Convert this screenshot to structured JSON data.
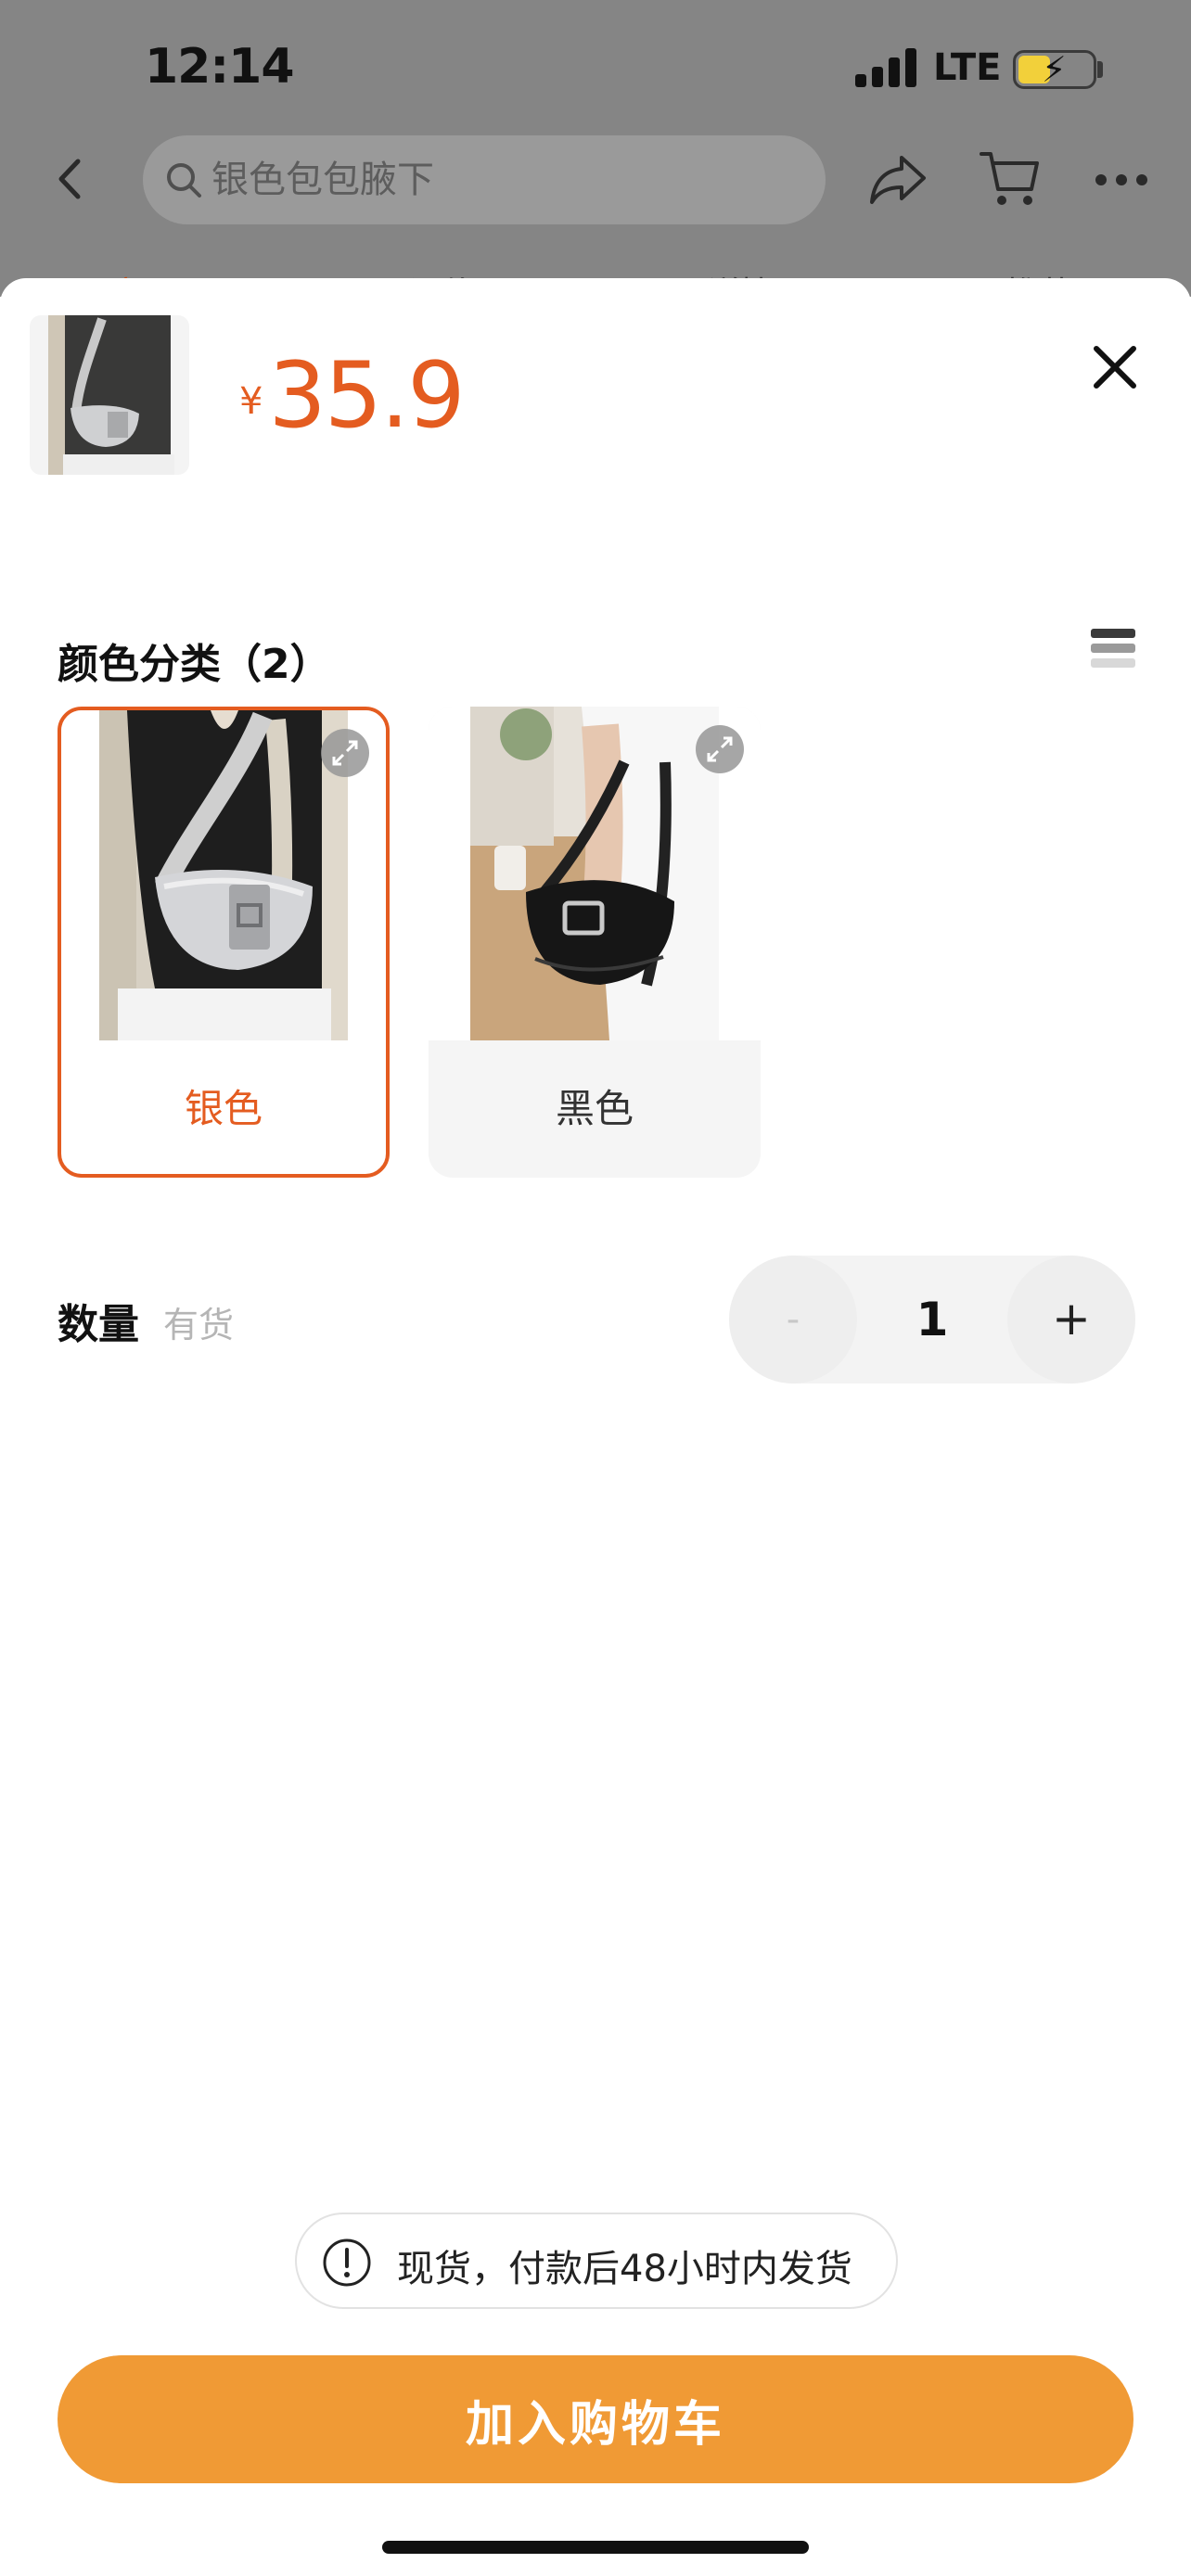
{
  "status_bar": {
    "time": "12:14",
    "network": "LTE"
  },
  "search": {
    "placeholder": "银色包包腋下"
  },
  "tabs_peek": [
    "商品",
    "评价",
    "详情",
    "推荐"
  ],
  "product": {
    "currency": "¥",
    "price": "35.9"
  },
  "variant_section": {
    "title": "颜色分类（2）",
    "options": [
      {
        "label": "银色",
        "selected": true
      },
      {
        "label": "黑色",
        "selected": false
      }
    ]
  },
  "quantity": {
    "label": "数量",
    "stock": "有货",
    "value": "1",
    "minus": "-",
    "plus": "+"
  },
  "notice": {
    "text": "现货，付款后48小时内发货"
  },
  "cta": {
    "label": "加入购物车"
  },
  "colors": {
    "accent": "#e45c20",
    "button": "#f09a35"
  },
  "icons": [
    "back-icon",
    "search-icon",
    "share-icon",
    "cart-icon",
    "more-icon",
    "close-icon",
    "list-view-icon",
    "expand-icon",
    "alert-icon"
  ]
}
